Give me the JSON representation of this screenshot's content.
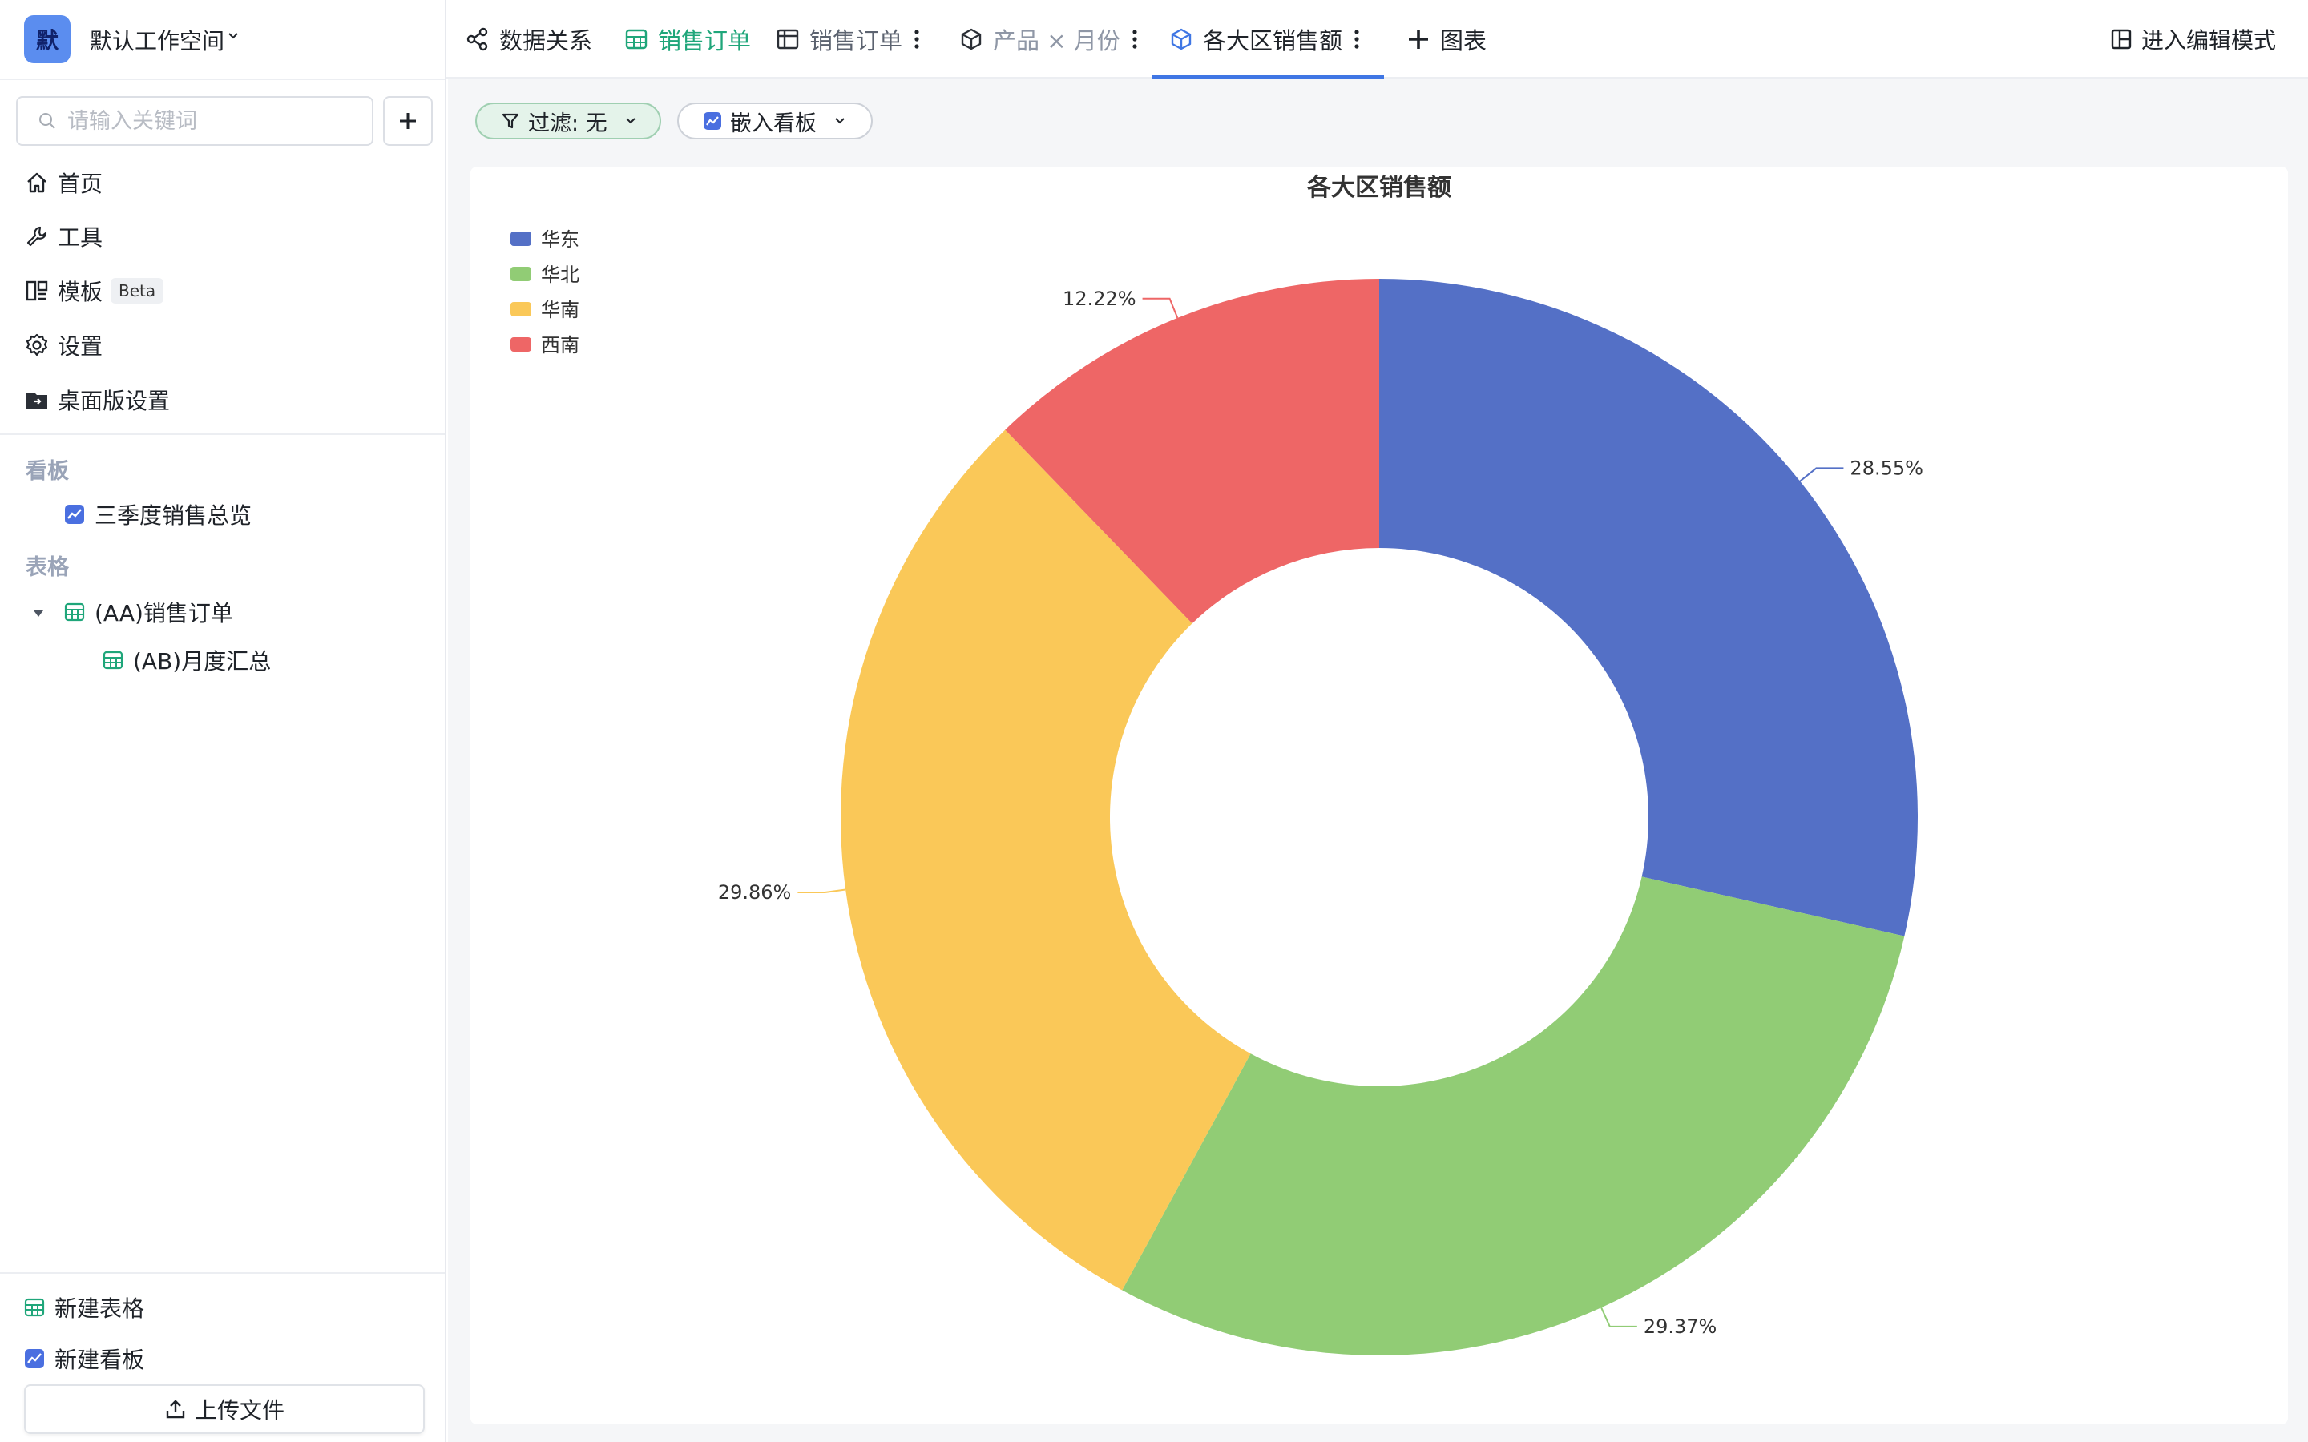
{
  "workspace": {
    "avatar": "默",
    "name": "默认工作空间"
  },
  "search": {
    "placeholder": "请输入关键词"
  },
  "sidebar": {
    "nav": [
      {
        "label": "首页",
        "icon": "home-icon"
      },
      {
        "label": "工具",
        "icon": "wrench-icon"
      },
      {
        "label": "模板",
        "icon": "template-icon",
        "badge": "Beta"
      },
      {
        "label": "设置",
        "icon": "gear-icon"
      },
      {
        "label": "桌面版设置",
        "icon": "desktop-folder-icon"
      }
    ],
    "dashboards_label": "看板",
    "dashboards": [
      {
        "label": "三季度销售总览",
        "icon": "dashboard-icon"
      }
    ],
    "tables_label": "表格",
    "tables": [
      {
        "label": "(AA)销售订单",
        "icon": "table-icon",
        "expanded": true
      },
      {
        "label": "(AB)月度汇总",
        "icon": "table-icon"
      }
    ],
    "bottom": [
      {
        "label": "新建表格",
        "icon": "table-icon"
      },
      {
        "label": "新建看板",
        "icon": "dashboard-icon"
      }
    ],
    "upload_label": "上传文件"
  },
  "tabs": [
    {
      "label": "数据关系",
      "icon": "share-icon"
    },
    {
      "label": "销售订单",
      "icon": "table-icon"
    },
    {
      "label": "销售订单",
      "icon": "pivot-icon"
    },
    {
      "label": "产品 × 月份",
      "icon": "cube-icon"
    },
    {
      "label": "各大区销售额",
      "icon": "cube-icon",
      "active": true
    },
    {
      "label": "图表",
      "icon": "plus-icon"
    }
  ],
  "edit_mode_label": "进入编辑模式",
  "toolbar": {
    "filter_label": "过滤: 无",
    "embed_label": "嵌入看板"
  },
  "colors": {
    "accent": "#3f76e4",
    "teal": "#1fa67a"
  },
  "chart_data": {
    "type": "pie",
    "title": "各大区销售额",
    "donut": true,
    "legend_position": "top-left",
    "slices": [
      {
        "name": "华东",
        "percent": 28.55,
        "label": "28.55%",
        "color": "#5470c6"
      },
      {
        "name": "华北",
        "percent": 29.37,
        "label": "29.37%",
        "color": "#91cc75"
      },
      {
        "name": "华南",
        "percent": 29.86,
        "label": "29.86%",
        "color": "#fac858"
      },
      {
        "name": "西南",
        "percent": 12.22,
        "label": "12.22%",
        "color": "#ee6666"
      }
    ]
  }
}
